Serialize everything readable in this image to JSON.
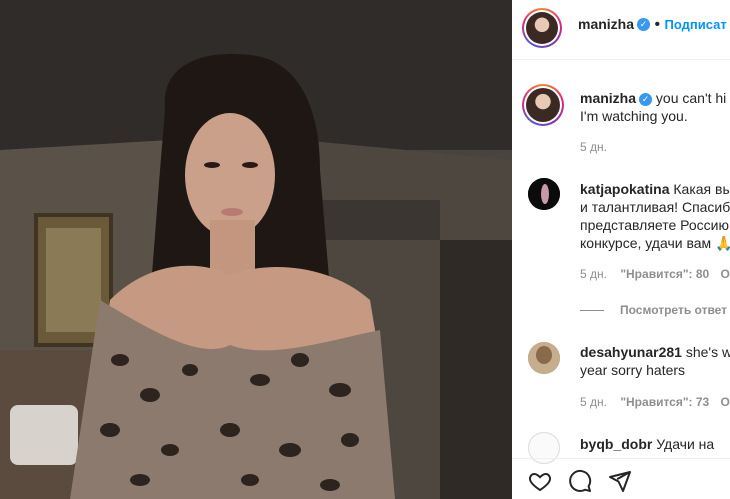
{
  "post": {
    "username": "manizha",
    "follow_label": "Подписат",
    "caption": "you can't hi",
    "caption_line2": "I'm watching you.",
    "time": "5 дн."
  },
  "comments": [
    {
      "username": "katjapokatina",
      "lines": [
        "Какая вы",
        "и талантливая! Спасиб",
        "представляете Россию",
        "конкурсе, удачи вам 🙏"
      ],
      "time": "5 дн.",
      "likes": "\"Нравится\": 80",
      "reply": "От",
      "view_replies": "Посмотреть ответ"
    },
    {
      "username": "desahyunar281",
      "lines": [
        "she's w",
        "year sorry haters"
      ],
      "time": "5 дн.",
      "likes": "\"Нравится\": 73",
      "reply": "От"
    },
    {
      "username": "byqb_dobr",
      "lines": [
        "Удачи на"
      ]
    }
  ],
  "icons": {
    "like": "heart-icon",
    "comment": "comment-icon",
    "share": "share-icon"
  },
  "colors": {
    "verified": "#3897f0",
    "follow": "#0095f6",
    "muted": "#8e8e8e"
  }
}
